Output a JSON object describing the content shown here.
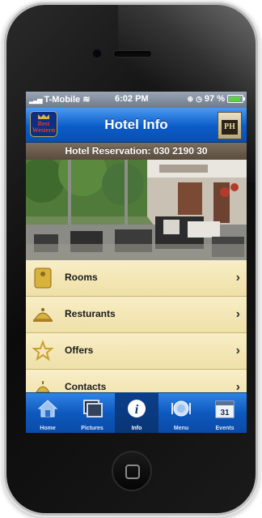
{
  "status": {
    "carrier": "T-Mobile",
    "time": "6:02 PM",
    "battery": "97 %"
  },
  "nav": {
    "title": "Hotel Info",
    "logo_text": "Best Western",
    "emblem_text": "PH"
  },
  "reservation": {
    "text": "Hotel Reservation: 030 2190 30"
  },
  "menu": [
    {
      "label": "Rooms",
      "icon": "room-key-icon"
    },
    {
      "label": "Resturants",
      "icon": "cloche-icon"
    },
    {
      "label": "Offers",
      "icon": "star-icon"
    },
    {
      "label": "Contacts",
      "icon": "reception-bell-icon"
    }
  ],
  "tabs": [
    {
      "label": "Home",
      "icon": "home-icon",
      "active": false
    },
    {
      "label": "Pictures",
      "icon": "pictures-icon",
      "active": false
    },
    {
      "label": "Info",
      "icon": "info-icon",
      "active": true
    },
    {
      "label": "Menu",
      "icon": "plate-icon",
      "active": false
    },
    {
      "label": "Events",
      "icon": "calendar-icon",
      "active": false
    }
  ],
  "calendar_day": "31",
  "colors": {
    "accent": "#0b5cc8",
    "reservation_bar": "#6b5d4d",
    "menu_bg": "#f4e7b8"
  }
}
